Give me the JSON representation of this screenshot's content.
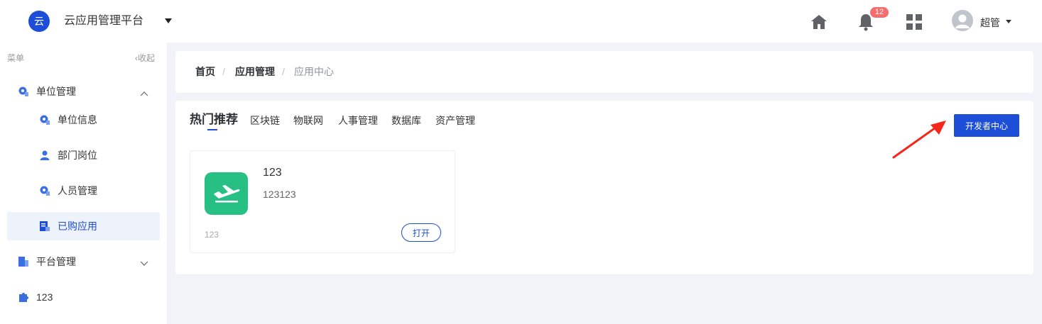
{
  "header": {
    "logo_text": "云",
    "app_title": "云应用管理平台",
    "notification_count": "12",
    "user_name": "超管",
    "icons": [
      "home-icon",
      "bell-icon",
      "grid-apps-icon",
      "user-avatar-icon"
    ]
  },
  "sidebar": {
    "menu_label": "菜单",
    "collapse_label": "‹收起",
    "items": [
      {
        "label": "单位管理",
        "icon": "org-gear-icon",
        "expanded": true
      },
      {
        "label": "单位信息",
        "icon": "org-gear-icon"
      },
      {
        "label": "部门岗位",
        "icon": "person-icon"
      },
      {
        "label": "人员管理",
        "icon": "org-gear-icon"
      },
      {
        "label": "已购应用",
        "icon": "purchased-app-icon",
        "active": true
      },
      {
        "label": "平台管理",
        "icon": "building-icon",
        "expanded": false
      },
      {
        "label": "123",
        "icon": "puzzle-icon"
      }
    ]
  },
  "breadcrumb": {
    "items": [
      "首页",
      "应用管理",
      "应用中心"
    ],
    "separator": "/"
  },
  "main": {
    "tabs": [
      "热门推荐",
      "区块链",
      "物联网",
      "人事管理",
      "数据库",
      "资产管理"
    ],
    "active_tab": "热门推荐",
    "developer_button": "开发者中心",
    "app_card": {
      "name": "123",
      "description": "123123",
      "footer": "123",
      "open_button": "打开",
      "icon": "plane-takeoff-icon",
      "icon_color": "#26bf84"
    }
  },
  "colors": {
    "primary": "#1d4ed8",
    "badge": "#f56c6c",
    "annotation_arrow": "#f5271b"
  }
}
